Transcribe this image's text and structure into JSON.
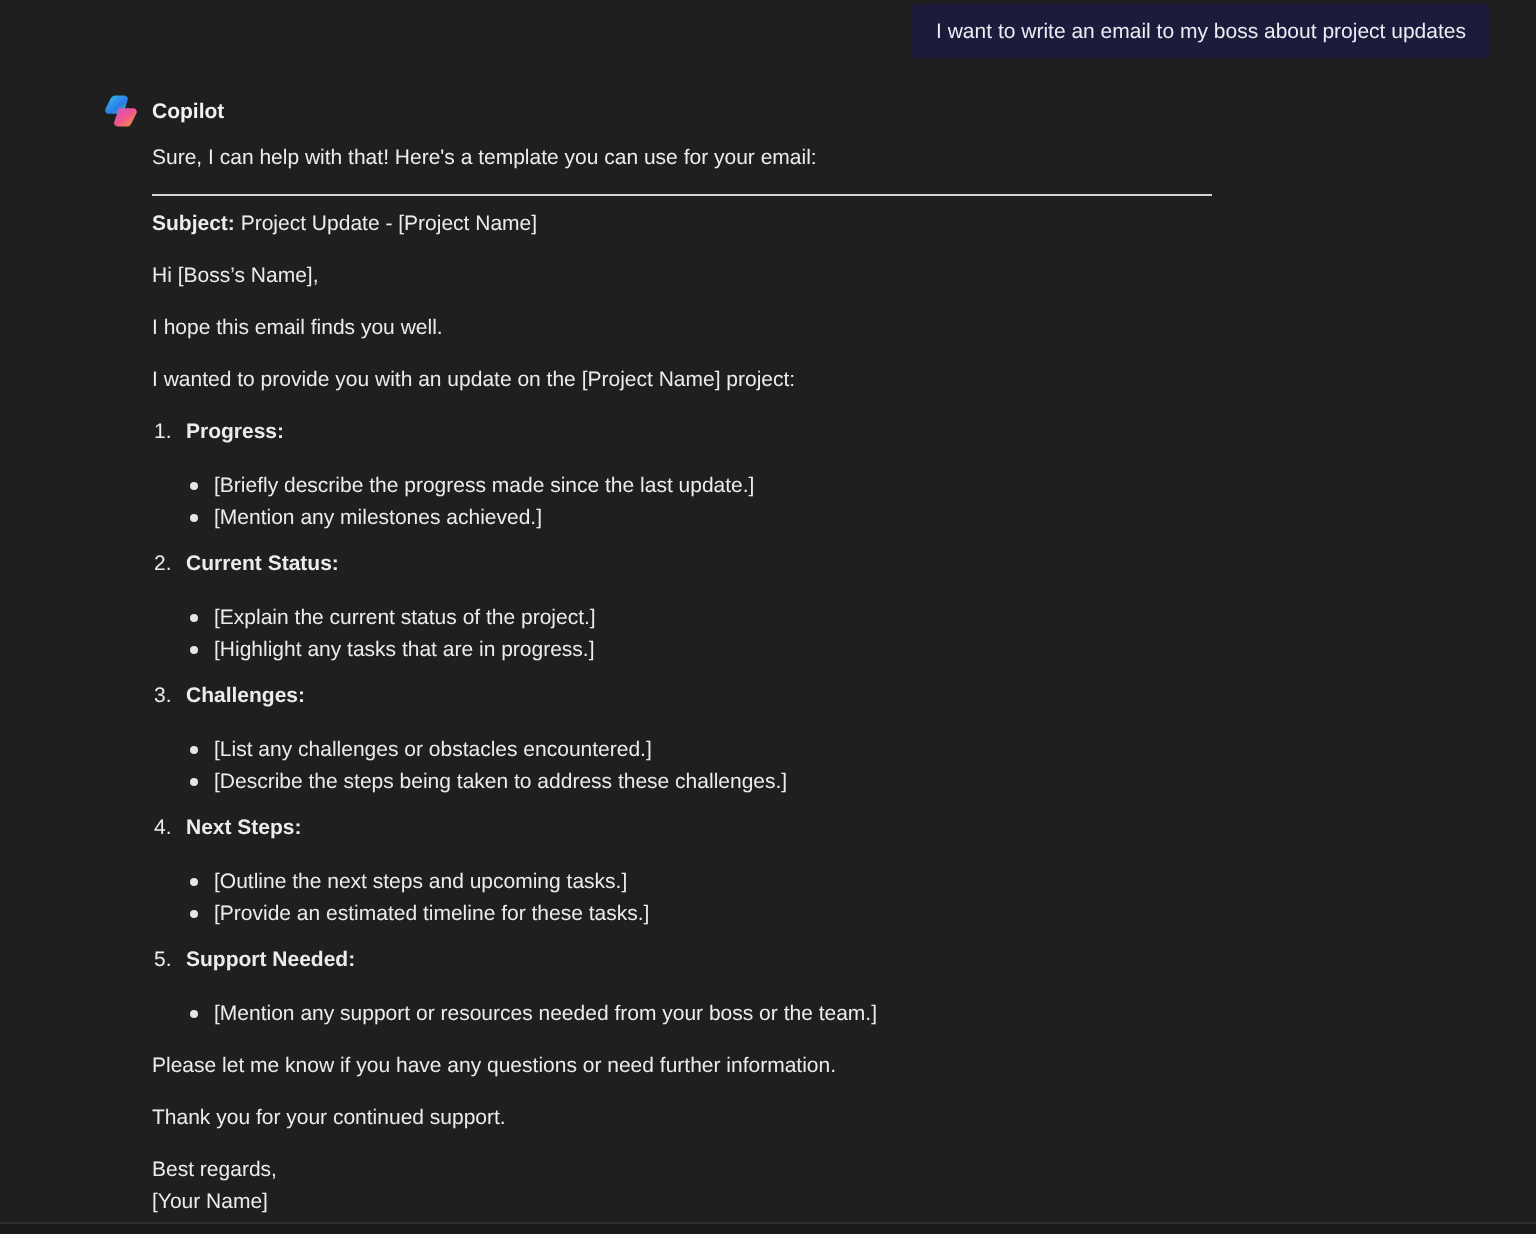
{
  "user_message": {
    "text": "I want to write an email to my boss about project updates"
  },
  "assistant": {
    "name": "Copilot",
    "intro": "Sure, I can help with that! Here's a template you can use for your email:",
    "email": {
      "subject": "**Subject:** Project Update - [Project Name]",
      "greeting": "Hi [Boss’s Name],",
      "opening": "I hope this email finds you well.",
      "lead": "I wanted to provide you with an update on the [Project Name] project:",
      "sections": [
        {
          "number": "1.",
          "title": "Progress:",
          "points": [
            "[Briefly describe the progress made since the last update.]",
            "[Mention any milestones achieved.]"
          ]
        },
        {
          "number": "2.",
          "title": "Current Status:",
          "points": [
            "[Explain the current status of the project.]",
            "[Highlight any tasks that are in progress.]"
          ]
        },
        {
          "number": "3.",
          "title": "Challenges:",
          "points": [
            "[List any challenges or obstacles encountered.]",
            "[Describe the steps being taken to address these challenges.]"
          ]
        },
        {
          "number": "4.",
          "title": "Next Steps:",
          "points": [
            "[Outline the next steps and upcoming tasks.]",
            "[Provide an estimated timeline for these tasks.]"
          ]
        },
        {
          "number": "5.",
          "title": "Support Needed:",
          "points": [
            "[Mention any support or resources needed from your boss or the team.]"
          ]
        }
      ],
      "closing": "Please let me know if you have any questions or need further information.",
      "thanks": "Thank you for your continued support.",
      "signoff": [
        "Best regards,",
        "[Your Name]"
      ]
    }
  }
}
